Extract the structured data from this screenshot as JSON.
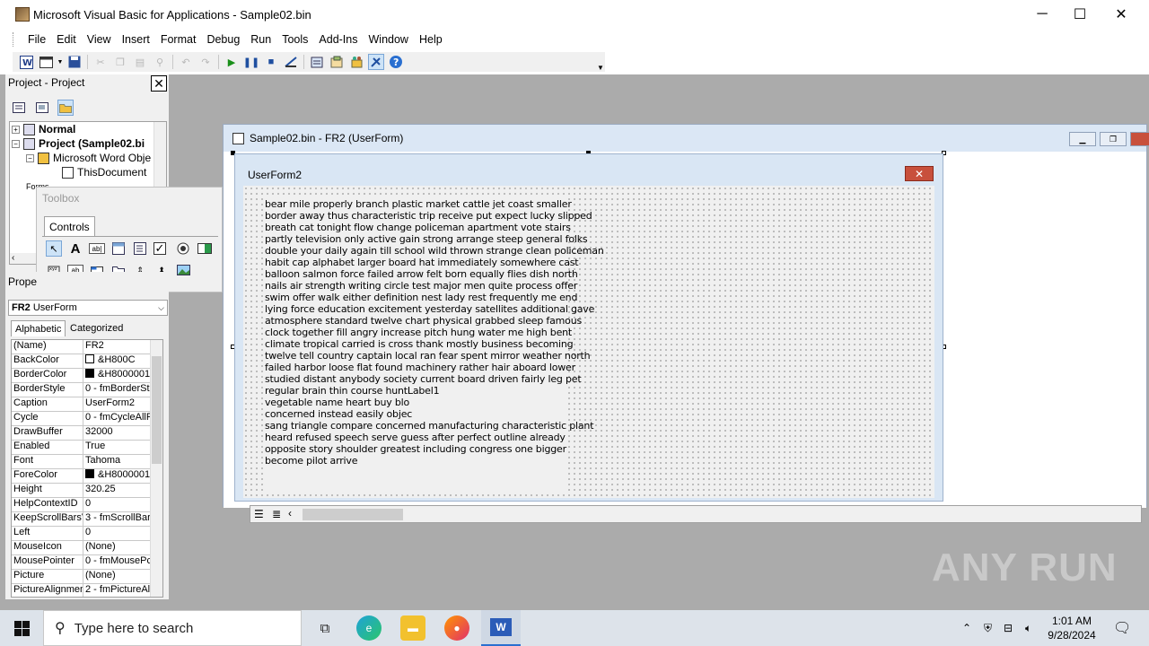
{
  "window": {
    "title": "Microsoft Visual Basic for Applications - Sample02.bin",
    "minimize": "─",
    "maximize": "☐",
    "close": "✕"
  },
  "menu": [
    "File",
    "Edit",
    "View",
    "Insert",
    "Format",
    "Debug",
    "Run",
    "Tools",
    "Add-Ins",
    "Window",
    "Help"
  ],
  "toolbar": {
    "buttons": [
      "word-icon",
      "insert-userform-icon",
      "save-icon",
      "cut-icon",
      "copy-icon",
      "paste-icon",
      "find-icon",
      "undo-icon",
      "redo-icon",
      "run-icon",
      "break-icon",
      "reset-icon",
      "design-mode-icon",
      "project-explorer-icon",
      "properties-icon",
      "object-browser-icon",
      "toolbox-icon",
      "help-icon"
    ]
  },
  "project_panel": {
    "title": "Project - Project",
    "tree": [
      {
        "label": "Normal",
        "bold": true
      },
      {
        "label": "Project (Sample02.bi",
        "bold": true
      },
      {
        "label": "Microsoft Word Obje",
        "bold": false
      },
      {
        "label": "ThisDocument",
        "bold": false
      },
      {
        "label": "Forms",
        "bold": false
      }
    ]
  },
  "toolbox": {
    "title": "Toolbox",
    "tab": "Controls",
    "tools": [
      "pointer-icon",
      "label-tool-icon",
      "textbox-tool-icon",
      "combobox-tool-icon",
      "listbox-tool-icon",
      "checkbox-tool-icon",
      "optionbutton-tool-icon",
      "togglebutton-tool-icon",
      "frame-tool-icon",
      "commandbutton-tool-icon",
      "tabstrip-tool-icon",
      "multipage-tool-icon",
      "scrollbar-tool-icon",
      "spinbutton-tool-icon",
      "image-tool-icon"
    ]
  },
  "properties_panel": {
    "title": "Prope",
    "object": "FR2",
    "object_type": "UserForm",
    "tab_alphabetic": "Alphabetic",
    "tab_categorized": "Categorized",
    "rows": [
      {
        "name": "(Name)",
        "value": "FR2"
      },
      {
        "name": "BackColor",
        "value": "&H800C",
        "swatch": "#ffffff"
      },
      {
        "name": "BorderColor",
        "value": "&H8000001",
        "swatch": "#000000"
      },
      {
        "name": "BorderStyle",
        "value": "0 - fmBorderSt"
      },
      {
        "name": "Caption",
        "value": "UserForm2"
      },
      {
        "name": "Cycle",
        "value": "0 - fmCycleAllF"
      },
      {
        "name": "DrawBuffer",
        "value": "32000"
      },
      {
        "name": "Enabled",
        "value": "True"
      },
      {
        "name": "Font",
        "value": "Tahoma"
      },
      {
        "name": "ForeColor",
        "value": "&H8000001",
        "swatch": "#000000"
      },
      {
        "name": "Height",
        "value": "320.25"
      },
      {
        "name": "HelpContextID",
        "value": "0"
      },
      {
        "name": "KeepScrollBarsV",
        "value": "3 - fmScrollBar"
      },
      {
        "name": "Left",
        "value": "0"
      },
      {
        "name": "MouseIcon",
        "value": "(None)"
      },
      {
        "name": "MousePointer",
        "value": "0 - fmMousePc"
      },
      {
        "name": "Picture",
        "value": "(None)"
      },
      {
        "name": "PictureAlignmen",
        "value": "2 - fmPictureAl"
      }
    ]
  },
  "designer": {
    "title": "Sample02.bin - FR2 (UserForm)",
    "form_caption": "UserForm2",
    "label_lines": [
      "bear mile properly branch plastic market cattle jet coast smaller",
      "border away thus characteristic trip receive put expect lucky slipped",
      "breath cat tonight flow change policeman apartment vote stairs",
      "partly television only active gain strong arrange steep general folks",
      "double your daily again till school wild thrown strange clean policeman",
      "habit cap alphabet larger board hat immediately somewhere cast",
      "balloon salmon force failed arrow felt born equally flies dish north",
      "nails air strength writing circle test major men quite process offer",
      "swim offer walk either definition nest lady rest frequently me end",
      "lying force education excitement yesterday satellites additional gave",
      "atmosphere standard twelve chart physical grabbed sleep famous",
      "clock together fill angry increase pitch hung water me high bent",
      "climate tropical carried is cross thank mostly business becoming",
      "twelve tell country captain local ran fear spent mirror weather north",
      "failed harbor loose flat found machinery rather hair aboard lower",
      "studied distant anybody society current board driven fairly leg pet",
      "regular brain thin course huntLabel1",
      "vegetable name heart buy blo",
      "concerned instead easily objec",
      "sang triangle compare concerned manufacturing characteristic plant",
      "heard refused speech serve guess after perfect outline already",
      "opposite story shoulder greatest including congress one bigger",
      "become pilot arrive"
    ]
  },
  "taskbar": {
    "search_placeholder": "Type here to search",
    "time": "1:01 AM",
    "date": "9/28/2024"
  },
  "watermark": "ANY RUN"
}
